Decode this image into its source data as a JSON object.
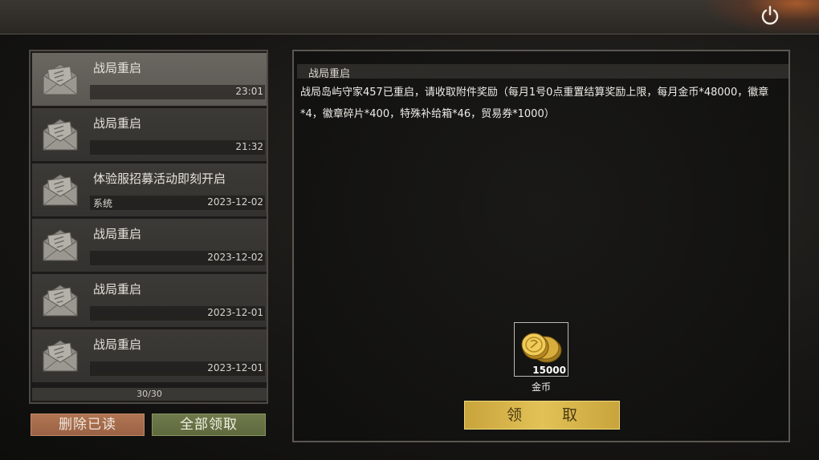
{
  "header": {
    "power_icon": "power-icon"
  },
  "mails": [
    {
      "title": "战局重启",
      "sender": "",
      "time": "23:01",
      "selected": true
    },
    {
      "title": "战局重启",
      "sender": "",
      "time": "21:32",
      "selected": false
    },
    {
      "title": "体验服招募活动即刻开启",
      "sender": "系统",
      "time": "2023-12-02",
      "selected": false
    },
    {
      "title": "战局重启",
      "sender": "",
      "time": "2023-12-02",
      "selected": false
    },
    {
      "title": "战局重启",
      "sender": "",
      "time": "2023-12-01",
      "selected": false
    },
    {
      "title": "战局重启",
      "sender": "",
      "time": "2023-12-01",
      "selected": false
    }
  ],
  "list_counter": "30/30",
  "buttons": {
    "delete_read": "删除已读",
    "claim_all": "全部领取",
    "claim": "领 取"
  },
  "detail": {
    "title": "战局重启",
    "body": "战局岛屿守家457已重启，请收取附件奖励（每月1号0点重置结算奖励上限，每月金币*48000，徽章*4，徽章碎片*400，特殊补给箱*46，贸易券*1000）"
  },
  "reward": {
    "icon": "gold-coins-icon",
    "count": "15000",
    "name": "金币"
  },
  "colors": {
    "accent_gold": "#e2c257",
    "delete_button": "#a86b4c",
    "claim_all_button": "#66723f"
  }
}
